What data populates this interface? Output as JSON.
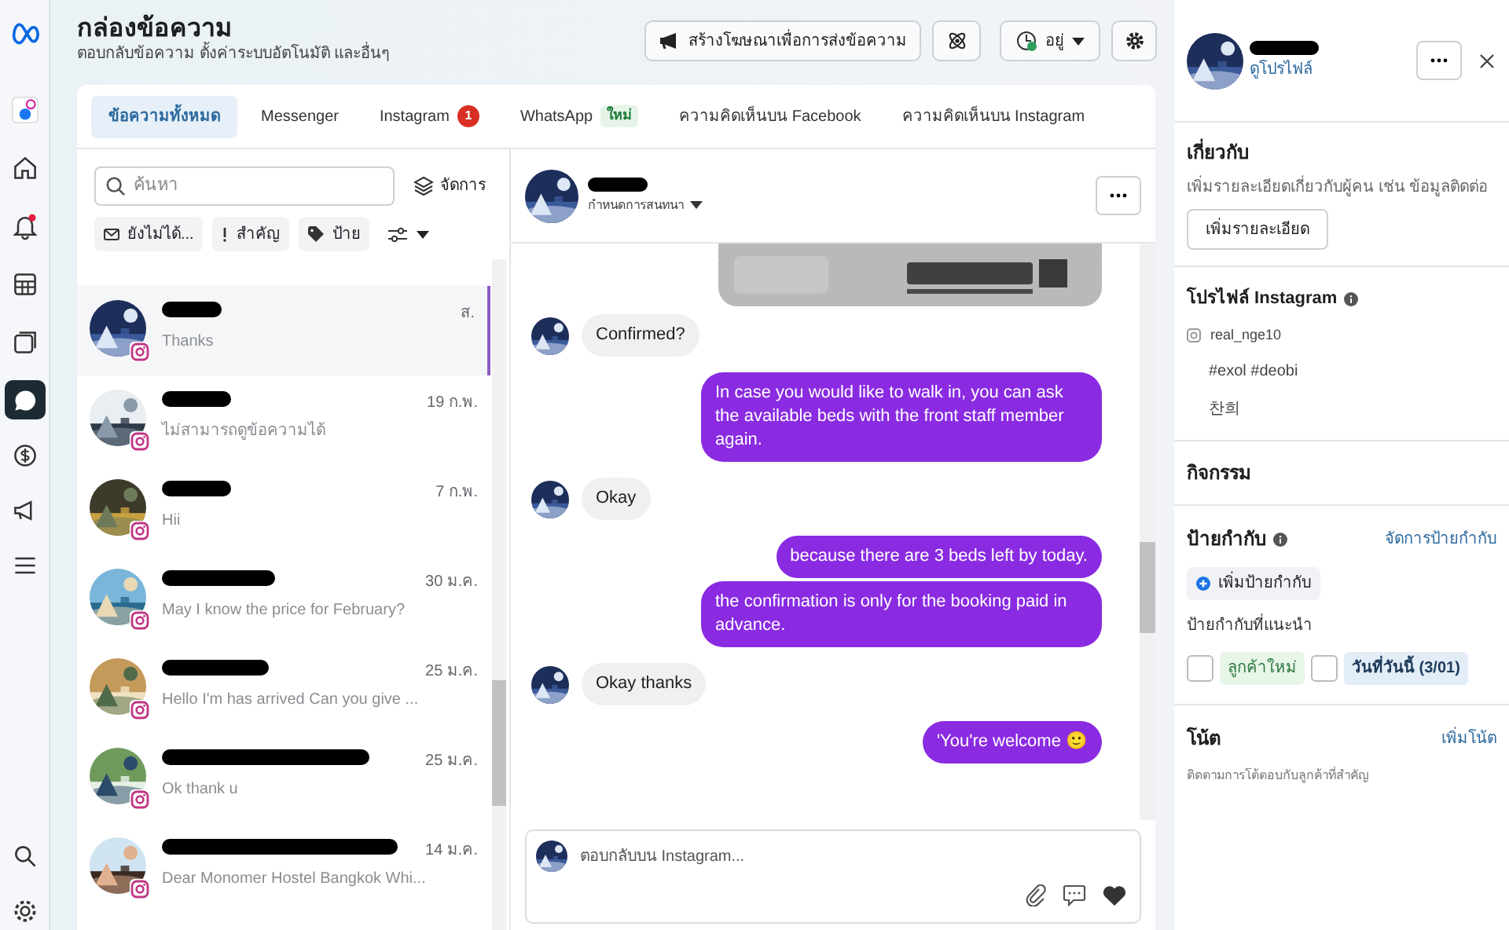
{
  "rail": [
    {
      "selected": false
    },
    {
      "selected": false
    },
    {
      "selected": false
    },
    {
      "selected": false
    },
    {
      "selected": false
    },
    {
      "selected": false
    },
    {
      "selected": true
    },
    {
      "selected": false
    },
    {
      "selected": false
    },
    {
      "selected": false
    },
    {
      "selected": false
    },
    {
      "selected": false
    }
  ],
  "header": {
    "title": "กล่องข้อความ",
    "subtitle": "ตอบกลับข้อความ ตั้งค่าระบบอัตโนมัติ และอื่นๆ",
    "promote_button": "สร้างโฆษณาเพื่อการส่งข้อความ",
    "status": "อยู่"
  },
  "tabs": [
    {
      "label": "ข้อความทั้งหมด",
      "selected": true
    },
    {
      "label": "Messenger",
      "selected": false
    },
    {
      "label": "Instagram",
      "selected": false,
      "badge": {
        "kind": "count",
        "text": "1"
      }
    },
    {
      "label": "WhatsApp",
      "selected": false,
      "badge": {
        "kind": "new",
        "text": "ใหม่"
      }
    },
    {
      "label": "ความคิดเห็นบน Facebook",
      "selected": false
    },
    {
      "label": "ความคิดเห็นบน Instagram",
      "selected": false
    }
  ],
  "inbox": {
    "search": {
      "placeholder": "ค้นหา"
    },
    "manage": "จัดการ",
    "filters": [
      "ยังไม่ได้...",
      "สำคัญ",
      "ป้าย"
    ],
    "conversations": [
      {
        "preview": "Thanks",
        "time": "ส.",
        "selected": true
      },
      {
        "preview": "ไม่สามารถดูข้อความได้",
        "time": "19 ก.พ.",
        "selected": false
      },
      {
        "preview": "Hii",
        "time": "7 ก.พ.",
        "selected": false
      },
      {
        "preview": "May I know the price for February?",
        "time": "30 ม.ค.",
        "selected": false
      },
      {
        "preview": "Hello I'm has arrived Can you give ...",
        "time": "25 ม.ค.",
        "selected": false
      },
      {
        "preview": "Ok thank u",
        "time": "25 ม.ค.",
        "selected": false
      },
      {
        "preview": "Dear Monomer Hostel Bangkok Whi...",
        "time": "14 ม.ค.",
        "selected": false
      }
    ]
  },
  "chat": {
    "subtitle": "กำหนดการสนทนา",
    "messages": [
      {
        "kind": "picture",
        "outgoing": true
      },
      {
        "kind": "text",
        "outgoing": false,
        "text": "Confirmed?"
      },
      {
        "kind": "text",
        "outgoing": true,
        "text": "In case you would like to walk in, you can ask the available beds with the front staff member again."
      },
      {
        "kind": "text",
        "outgoing": false,
        "text": "Okay"
      },
      {
        "kind": "text",
        "outgoing": true,
        "text": "because there are 3 beds left by today."
      },
      {
        "kind": "text",
        "outgoing": true,
        "text": "the confirmation is only for the booking paid in advance."
      },
      {
        "kind": "text",
        "outgoing": false,
        "text": "Okay thanks"
      },
      {
        "kind": "text",
        "outgoing": true,
        "text": "'You're welcome 🙂"
      }
    ],
    "composer": {
      "placeholder": "ตอบกลับบน Instagram..."
    }
  },
  "profile": {
    "view_link": "ดูโปรไฟล์",
    "about": {
      "title": "เกี่ยวกับ",
      "description": "เพิ่มรายละเอียดเกี่ยวกับผู้คน เช่น ข้อมูลติดต่อ",
      "button": "เพิ่มรายละเอียด"
    },
    "instagram": {
      "title": "โปรไฟล์ Instagram",
      "handle": "real_nge10",
      "bio": [
        "#exol #deobi",
        "찬희"
      ]
    },
    "activity": {
      "title": "กิจกรรม"
    },
    "labels": {
      "title": "ป้ายกำกับ",
      "manage": "จัดการป้ายกำกับ",
      "add": "เพิ่มป้ายกำกับ",
      "suggested_title": "ป้ายกำกับที่แนะนำ",
      "suggestions": [
        {
          "text": "ลูกค้าใหม่",
          "color": "#e8f5e9",
          "checked": false
        },
        {
          "text": "วันที่วันนี้ (3/01)",
          "color": "#e3edf7",
          "checked": false
        }
      ]
    },
    "notes": {
      "title": "โน้ต",
      "add": "เพิ่มโน้ต",
      "description": "ติดตามการโต้ตอบกับลูกค้าที่สำคัญ"
    }
  }
}
